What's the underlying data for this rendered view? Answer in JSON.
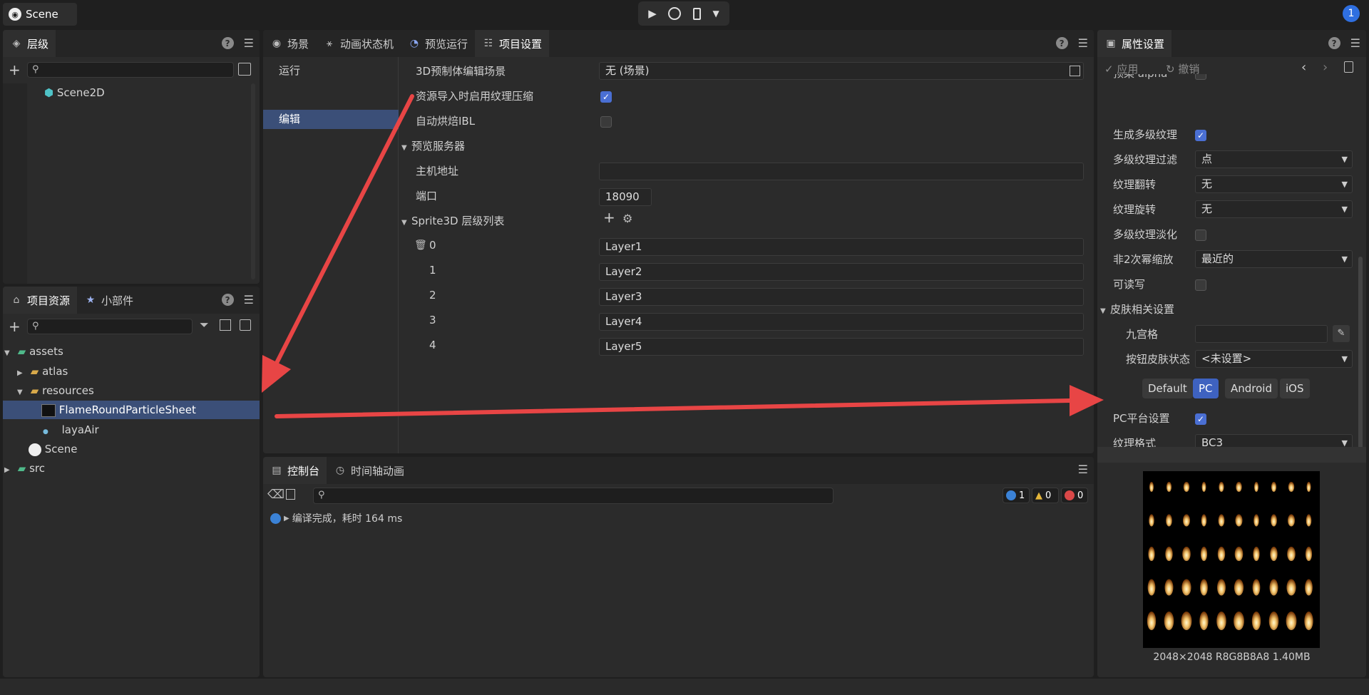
{
  "app": {
    "scene_tab": "Scene",
    "notification_count": "1"
  },
  "toolbar": {
    "play_icon": "play-icon",
    "web_icon": "globe-icon",
    "device_icon": "mobile-icon",
    "dropdown_icon": "chevron-down-icon"
  },
  "hierarchy": {
    "tab": "层级",
    "items": [
      {
        "label": "Scene2D"
      }
    ]
  },
  "assets_panel": {
    "tabs": [
      "项目资源",
      "小部件"
    ],
    "tree": [
      {
        "label": "assets",
        "icon": "assets-folder-icon"
      },
      {
        "label": "atlas",
        "icon": "folder-icon"
      },
      {
        "label": "resources",
        "icon": "folder-open-icon"
      },
      {
        "label": "FlameRoundParticleSheet",
        "icon": "image-icon",
        "selected": true
      },
      {
        "label": "layaAir",
        "icon": "dot-icon"
      },
      {
        "label": "Scene",
        "icon": "scene-icon"
      },
      {
        "label": "src",
        "icon": "code-folder-icon"
      }
    ]
  },
  "center": {
    "tabs": [
      "场景",
      "动画状态机",
      "预览运行",
      "项目设置"
    ],
    "active_tab": "项目设置",
    "side_nav": [
      "运行",
      "编辑"
    ],
    "active_nav": "编辑",
    "rows": {
      "prefab_scene_label": "3D预制体编辑场景",
      "prefab_scene_value": "无 (场景)",
      "compress_label": "资源导入时启用纹理压缩",
      "compress_checked": true,
      "ibl_label": "自动烘焙IBL",
      "ibl_checked": false,
      "preview_server_label": "预览服务器",
      "host_label": "主机地址",
      "host_value": "",
      "port_label": "端口",
      "port_value": "18090",
      "layers_label": "Sprite3D 层级列表",
      "layers": [
        {
          "index": "0",
          "name": "Layer1"
        },
        {
          "index": "1",
          "name": "Layer2"
        },
        {
          "index": "2",
          "name": "Layer3"
        },
        {
          "index": "3",
          "name": "Layer4"
        },
        {
          "index": "4",
          "name": "Layer5"
        }
      ]
    }
  },
  "console": {
    "tabs": [
      "控制台",
      "时间轴动画"
    ],
    "counts": {
      "info": "1",
      "warn": "0",
      "error": "0"
    },
    "messages": [
      "编译完成，耗时 164 ms"
    ]
  },
  "inspector": {
    "tab": "属性设置",
    "apply_label": "应用",
    "revert_label": "撤销",
    "partial_label": "预乘 alpha",
    "rows": {
      "mipmap_label": "生成多级纹理",
      "mipmap_checked": true,
      "mip_filter_label": "多级纹理过滤",
      "mip_filter_value": "点",
      "flip_label": "纹理翻转",
      "flip_value": "无",
      "rotate_label": "纹理旋转",
      "rotate_value": "无",
      "fade_label": "多级纹理淡化",
      "fade_checked": false,
      "npot_label": "非2次幂缩放",
      "npot_value": "最近的",
      "readable_label": "可读写",
      "readable_checked": false,
      "skin_section": "皮肤相关设置",
      "nine_label": "九宫格",
      "nine_value": "",
      "btn_skin_label": "按钮皮肤状态",
      "btn_skin_value": "<未设置>",
      "pc_setting_label": "PC平台设置",
      "pc_setting_checked": true,
      "format_label": "纹理格式",
      "format_value": "BC3"
    },
    "platforms": [
      "Default",
      "PC",
      "Android",
      "iOS"
    ],
    "active_platform": "PC",
    "preview_info": "2048×2048 R8G8B8A8 1.40MB"
  },
  "colors": {
    "accent": "#4a6fd3",
    "arrow": "#e84545",
    "selection": "#3b4f78"
  }
}
